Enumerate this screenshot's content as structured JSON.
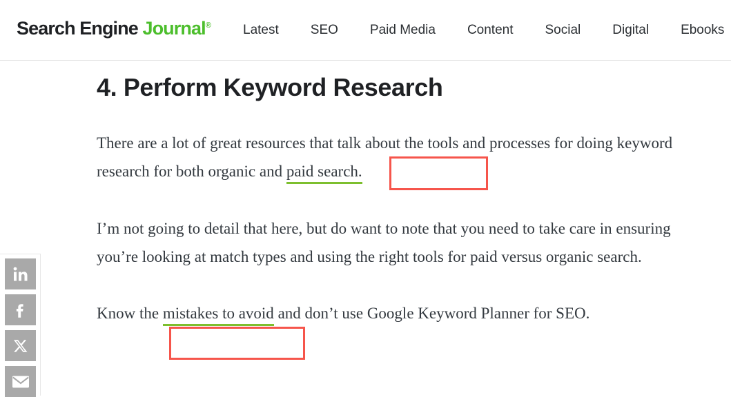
{
  "site": {
    "logo": {
      "part_dark": "Search Engine ",
      "part_green": "Journal",
      "registered_mark": "®",
      "green_hex": "#4CBE2C"
    },
    "nav": [
      {
        "label": "Latest",
        "name": "nav-item-latest"
      },
      {
        "label": "SEO",
        "name": "nav-item-seo"
      },
      {
        "label": "Paid Media",
        "name": "nav-item-paid-media"
      },
      {
        "label": "Content",
        "name": "nav-item-content"
      },
      {
        "label": "Social",
        "name": "nav-item-social"
      },
      {
        "label": "Digital",
        "name": "nav-item-digital"
      },
      {
        "label": "Ebooks",
        "name": "nav-item-ebooks"
      }
    ]
  },
  "social_rail": {
    "items": [
      {
        "icon": "linkedin-icon",
        "label": "LinkedIn"
      },
      {
        "icon": "facebook-icon",
        "label": "Facebook"
      },
      {
        "icon": "x-twitter-icon",
        "label": "X"
      },
      {
        "icon": "email-icon",
        "label": "Email"
      }
    ],
    "button_color": "#a9a9a9"
  },
  "article": {
    "title": "4. Perform Keyword Research",
    "paragraph_1": {
      "before_link": "There are a lot of great resources that talk about the tools and processes for doing keyword research for both organic and ",
      "link_text": "paid search.",
      "after_link": ""
    },
    "paragraph_2": "I’m not going to detail that here, but do want to note that you need to take care in ensuring you’re looking at match types and using the right tools for paid versus organic search.",
    "paragraph_3": {
      "before_link": "Know the ",
      "link_text": "mistakes to avoid",
      "after_link": " and don’t use Google Keyword Planner for SEO."
    },
    "link_underline_color": "#7dbf2e"
  },
  "annotations": {
    "box_color": "#f6554b",
    "boxes": [
      {
        "target": "paid search.",
        "name": "annotation-box-paid-search"
      },
      {
        "target": "mistakes to avoid",
        "name": "annotation-box-mistakes-to-avoid"
      }
    ]
  }
}
